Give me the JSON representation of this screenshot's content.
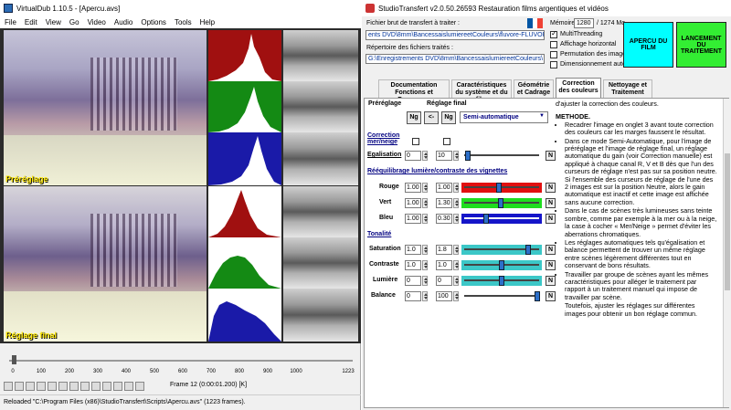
{
  "vdub": {
    "title": "VirtualDub 1.10.5 - [Apercu.avs]",
    "menu": [
      "File",
      "Edit",
      "View",
      "Go",
      "Video",
      "Audio",
      "Options",
      "Tools",
      "Help"
    ],
    "label_top": "Préréglage",
    "label_bottom": "Réglage final",
    "ticks": [
      "0",
      "100",
      "200",
      "300",
      "400",
      "500",
      "600",
      "700",
      "800",
      "900",
      "1000",
      "1223"
    ],
    "frame": "Frame 12 (0:00:01.200) [K]",
    "status": "Reloaded \"C:\\Program Files (x86)\\StudioTransfert\\Scripts\\Apercu.avs\" (1223 frames).",
    "colors": {
      "red": "#a01010",
      "green": "#148a14",
      "blue": "#1a1aa8"
    }
  },
  "st": {
    "title": "StudioTransfert v2.0.50.26593 Restauration films argentiques et vidéos",
    "brut_label": "Fichier brut de transfert à traiter :",
    "brut_value": "ents DVD\\8mm\\BancessaislumiereetCouleurs\\fluvore-FLUVORE.mp4",
    "traites_label": "Répertoire des fichiers traités :",
    "traites_value": "G:\\Enregistrements DVD\\8mm\\BancessaislumiereetCouleurs\\",
    "memoire_label": "Mémoire",
    "memoire_value": "1280",
    "memoire_total": "/ 1274 Mo",
    "options": [
      {
        "label": "MultiThreading",
        "checked": true
      },
      {
        "label": "Affichage horizontal",
        "checked": false
      },
      {
        "label": "Permutation des images",
        "checked": false
      },
      {
        "label": "Dimensionnement auto",
        "checked": false
      }
    ],
    "apercu_btn": "APERCU DU FILM",
    "lancement_btn": "LANCEMENT DU TRAITEMENT",
    "tabs": [
      "Documentation Fonctions et Processus",
      "Caractéristiques du système et du film",
      "Géométrie et Cadrage",
      "Correction des couleurs",
      "Nettoyage et Traitement"
    ],
    "panel": {
      "prereglage": "Préréglage",
      "reglage_final": "Réglage final",
      "ng": "Ng",
      "arrow": "<-",
      "mode": "Semi-automatique",
      "correction": "Correction mer/neige",
      "egalisation": "Egalisation",
      "egal_pre": "0",
      "egal_fin": "10",
      "reequilibrage": "Rééquilibrage lumière/contraste des vignettes",
      "rouge": "Rouge",
      "rouge_pre": "1.00",
      "rouge_fin": "1.00",
      "vert": "Vert",
      "vert_pre": "1.00",
      "vert_fin": "1.30",
      "bleu": "Bleu",
      "bleu_pre": "1.00",
      "bleu_fin": "0.30",
      "tonalite": "Tonalité",
      "saturation": "Saturation",
      "sat_pre": "1.0",
      "sat_fin": "1.8",
      "contraste": "Contraste",
      "con_pre": "1.0",
      "con_fin": "1.0",
      "lumiere": "Lumière",
      "lum_pre": "0",
      "lum_fin": "0",
      "balance": "Balance",
      "bal_pre": "0",
      "bal_fin": "100",
      "n": "N"
    },
    "help": {
      "intro": "d'ajuster la correction des couleurs.",
      "heading": "METHODE.",
      "b1": "Recadrer l'image en onglet 3 avant toute correction des couleurs car les marges faussent le résultat.",
      "b2": "Dans ce mode Semi-Automatique, pour l'image de préréglage et l'image de réglage final, un réglage automatique du gain (voir Correction manuelle) est appliqué à chaque canal R, V et B dès que l'un des curseurs de réglage n'est pas sur sa position neutre. Si l'ensemble des curseurs de réglage de l'une des 2 images est sur la position Neutre, alors le gain automatique est inactif et cette image est affichée sans aucune correction.",
      "b3": "Dans le cas de scènes très lumineuses sans teinte sombre, comme par exemple à la mer ou à la neige, la case à cocher « Mer/Neige » permet d'éviter les aberrations chromatiques.",
      "b4": "Les réglages automatiques tels qu'égalisation et balance permettent de trouver un même réglage entre scènes légèrement différentes tout en conservant de bons résultats.",
      "b5": "Travailler par groupe de scènes ayant les mêmes caractéristiques pour alléger le traitement par rapport à un traitement manuel qui impose de travailler par scène.",
      "tail": "Toutefois, ajuster les réglages sur différentes images pour obtenir un bon réglage commun."
    }
  }
}
